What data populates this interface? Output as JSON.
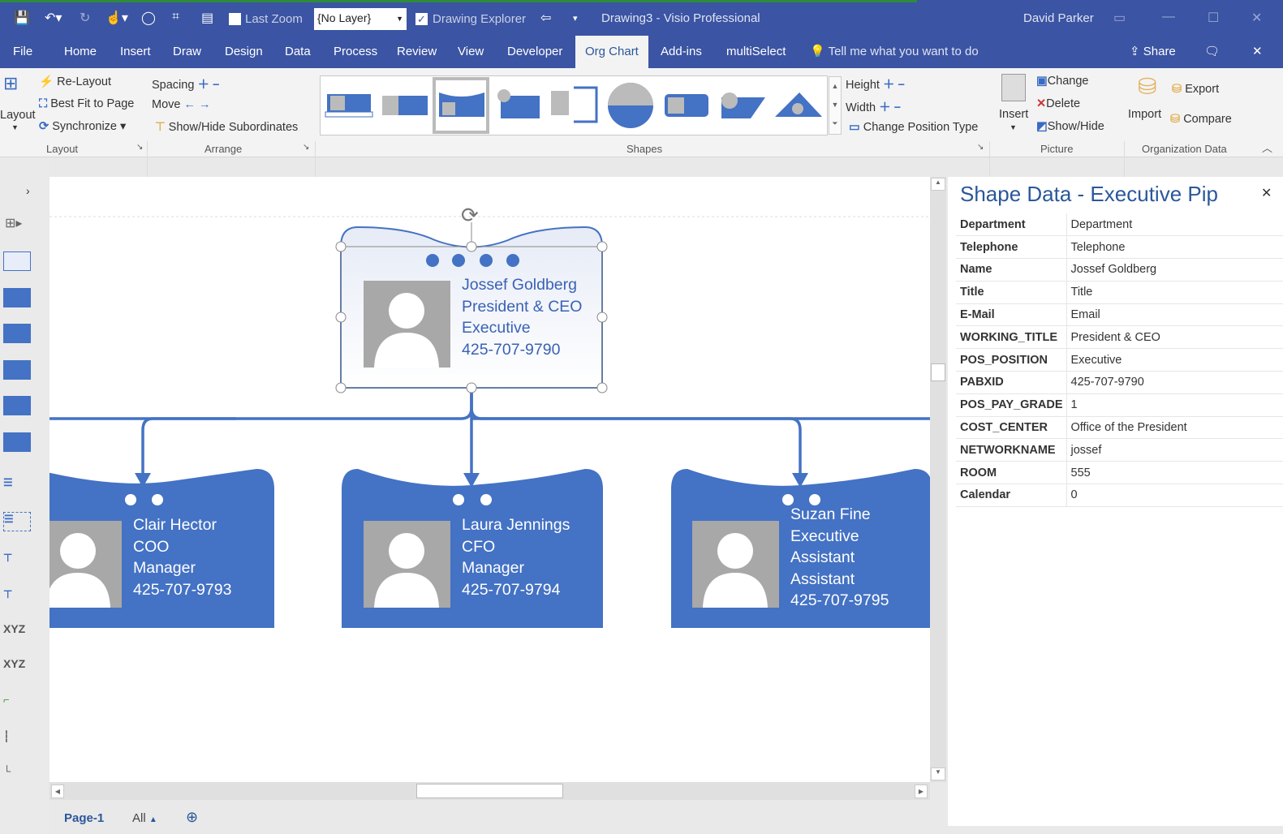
{
  "titlebar": {
    "last_zoom": "Last Zoom",
    "layer_select": "{No Layer}",
    "drawing_explorer": "Drawing Explorer",
    "title": "Drawing3  -  Visio Professional",
    "user": "David Parker"
  },
  "tabs": [
    {
      "label": "File"
    },
    {
      "label": "Home"
    },
    {
      "label": "Insert"
    },
    {
      "label": "Draw"
    },
    {
      "label": "Design"
    },
    {
      "label": "Data"
    },
    {
      "label": "Process"
    },
    {
      "label": "Review"
    },
    {
      "label": "View"
    },
    {
      "label": "Developer"
    },
    {
      "label": "Org Chart",
      "active": true
    },
    {
      "label": "Add-ins"
    },
    {
      "label": "multiSelect"
    }
  ],
  "tell_me": "Tell me what you want to do",
  "share": "Share",
  "ribbon": {
    "layout": {
      "layout": "Layout",
      "relayout": "Re-Layout",
      "best_fit": "Best Fit to Page",
      "synchronize": "Synchronize",
      "group": "Layout"
    },
    "arrange": {
      "spacing": "Spacing",
      "move": "Move",
      "show_hide": "Show/Hide Subordinates",
      "group": "Arrange"
    },
    "shapes": {
      "group": "Shapes",
      "height": "Height",
      "width": "Width",
      "change_position": "Change Position Type"
    },
    "picture": {
      "insert": "Insert",
      "change": "Change",
      "delete": "Delete",
      "show_hide": "Show/Hide",
      "group": "Picture"
    },
    "org_data": {
      "import": "Import",
      "export": "Export",
      "compare": "Compare",
      "group": "Organization Data"
    }
  },
  "accent": "#4472c4",
  "cards": [
    {
      "lines": [
        "Jossef Goldberg",
        "President & CEO",
        "Executive",
        "425-707-9790"
      ],
      "selected": true
    },
    {
      "lines": [
        "Clair Hector",
        "COO",
        "Manager",
        "425-707-9793"
      ]
    },
    {
      "lines": [
        "Laura Jennings",
        "CFO",
        "Manager",
        "425-707-9794"
      ]
    },
    {
      "lines": [
        "Suzan Fine",
        "Executive",
        "Assistant",
        "Assistant",
        "425-707-9795"
      ]
    }
  ],
  "panel": {
    "title": "Shape Data - Executive Pip",
    "rows": [
      {
        "k": "Department",
        "v": "Department"
      },
      {
        "k": "Telephone",
        "v": "Telephone"
      },
      {
        "k": "Name",
        "v": "Jossef Goldberg"
      },
      {
        "k": "Title",
        "v": "Title"
      },
      {
        "k": "E-Mail",
        "v": "Email"
      },
      {
        "k": "WORKING_TITLE",
        "v": "President & CEO"
      },
      {
        "k": "POS_POSITION",
        "v": "Executive"
      },
      {
        "k": "PABXID",
        "v": "425-707-9790"
      },
      {
        "k": "POS_PAY_GRADE",
        "v": "1"
      },
      {
        "k": "COST_CENTER",
        "v": "Office of the President"
      },
      {
        "k": "NETWORKNAME",
        "v": "jossef"
      },
      {
        "k": "ROOM",
        "v": "555"
      },
      {
        "k": "Calendar",
        "v": "0"
      }
    ]
  },
  "pages": {
    "page1": "Page-1",
    "all": "All"
  }
}
